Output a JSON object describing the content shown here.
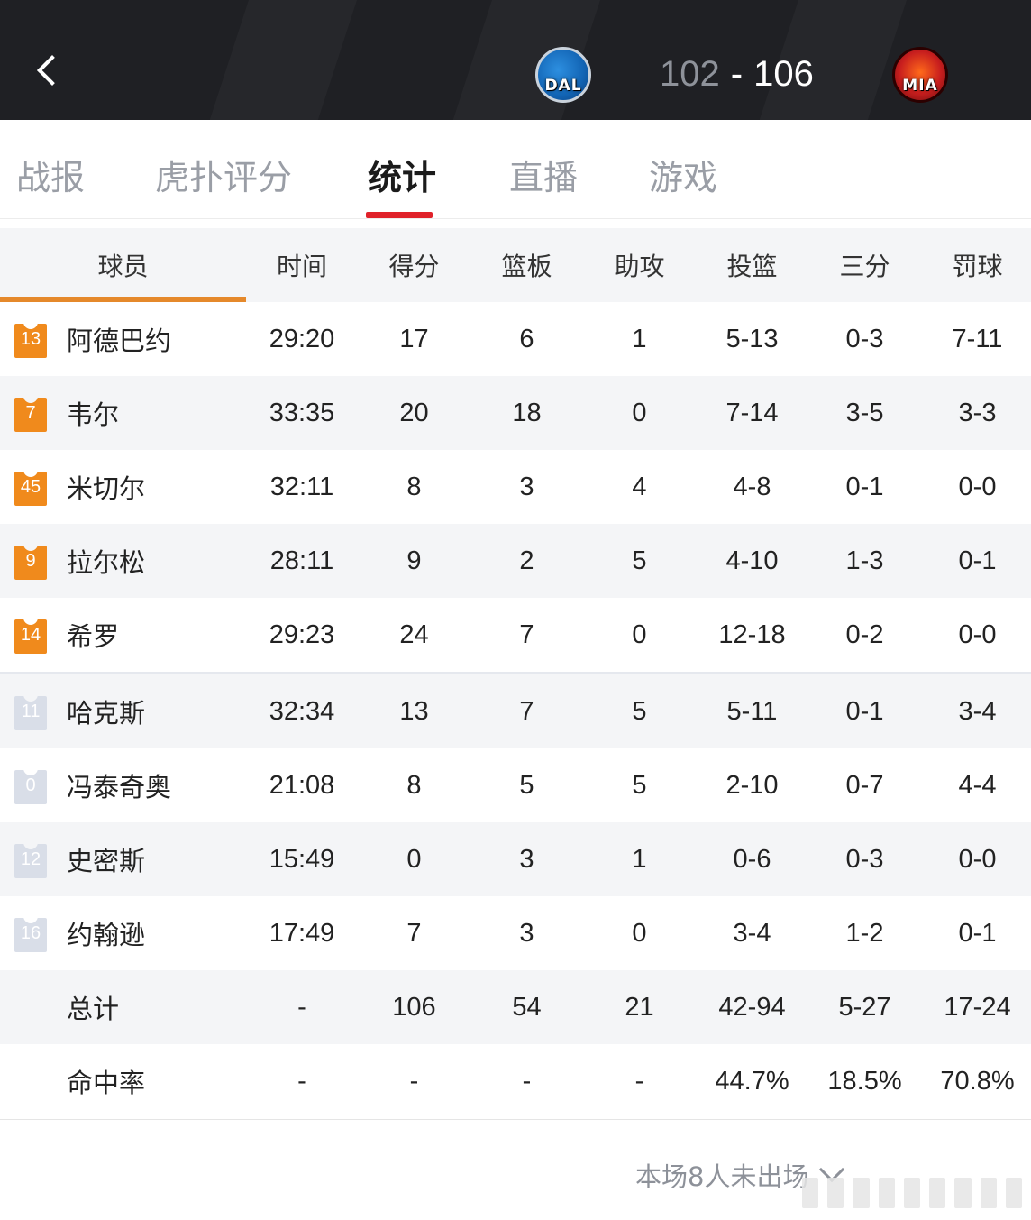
{
  "header": {
    "away_team": "DAL",
    "home_team": "MIA",
    "away_score": "102",
    "separator": "-",
    "home_score": "106",
    "colors": {
      "bar": "#1f2024",
      "away_score": "#8e929a",
      "home_score": "#ffffff"
    }
  },
  "tabs": [
    {
      "label": "战报",
      "active": false
    },
    {
      "label": "虎扑评分",
      "active": false
    },
    {
      "label": "统计",
      "active": true
    },
    {
      "label": "直播",
      "active": false
    },
    {
      "label": "游戏",
      "active": false
    }
  ],
  "accent": {
    "tab_underline": "#e0222a",
    "starter_jersey": "#f08a1c",
    "bench_jersey": "#d9dee8"
  },
  "table": {
    "columns": [
      "球员",
      "时间",
      "得分",
      "篮板",
      "助攻",
      "投篮",
      "三分",
      "罚球"
    ],
    "starters": [
      {
        "number": "13",
        "name": "阿德巴约",
        "time": "29:20",
        "pts": "17",
        "reb": "6",
        "ast": "1",
        "fg": "5-13",
        "tp": "0-3",
        "ft": "7-11"
      },
      {
        "number": "7",
        "name": "韦尔",
        "time": "33:35",
        "pts": "20",
        "reb": "18",
        "ast": "0",
        "fg": "7-14",
        "tp": "3-5",
        "ft": "3-3"
      },
      {
        "number": "45",
        "name": "米切尔",
        "time": "32:11",
        "pts": "8",
        "reb": "3",
        "ast": "4",
        "fg": "4-8",
        "tp": "0-1",
        "ft": "0-0"
      },
      {
        "number": "9",
        "name": "拉尔松",
        "time": "28:11",
        "pts": "9",
        "reb": "2",
        "ast": "5",
        "fg": "4-10",
        "tp": "1-3",
        "ft": "0-1"
      },
      {
        "number": "14",
        "name": "希罗",
        "time": "29:23",
        "pts": "24",
        "reb": "7",
        "ast": "0",
        "fg": "12-18",
        "tp": "0-2",
        "ft": "0-0"
      }
    ],
    "bench": [
      {
        "number": "11",
        "name": "哈克斯",
        "time": "32:34",
        "pts": "13",
        "reb": "7",
        "ast": "5",
        "fg": "5-11",
        "tp": "0-1",
        "ft": "3-4"
      },
      {
        "number": "0",
        "name": "冯泰奇奥",
        "time": "21:08",
        "pts": "8",
        "reb": "5",
        "ast": "5",
        "fg": "2-10",
        "tp": "0-7",
        "ft": "4-4"
      },
      {
        "number": "12",
        "name": "史密斯",
        "time": "15:49",
        "pts": "0",
        "reb": "3",
        "ast": "1",
        "fg": "0-6",
        "tp": "0-3",
        "ft": "0-0"
      },
      {
        "number": "16",
        "name": "约翰逊",
        "time": "17:49",
        "pts": "7",
        "reb": "3",
        "ast": "0",
        "fg": "3-4",
        "tp": "1-2",
        "ft": "0-1"
      }
    ],
    "totals": {
      "name": "总计",
      "time": "-",
      "pts": "106",
      "reb": "54",
      "ast": "21",
      "fg": "42-94",
      "tp": "5-27",
      "ft": "17-24"
    },
    "percent": {
      "name": "命中率",
      "time": "-",
      "pts": "-",
      "reb": "-",
      "ast": "-",
      "fg": "44.7%",
      "tp": "18.5%",
      "ft": "70.8%"
    }
  },
  "footer": {
    "dnp_label": "本场8人未出场"
  }
}
